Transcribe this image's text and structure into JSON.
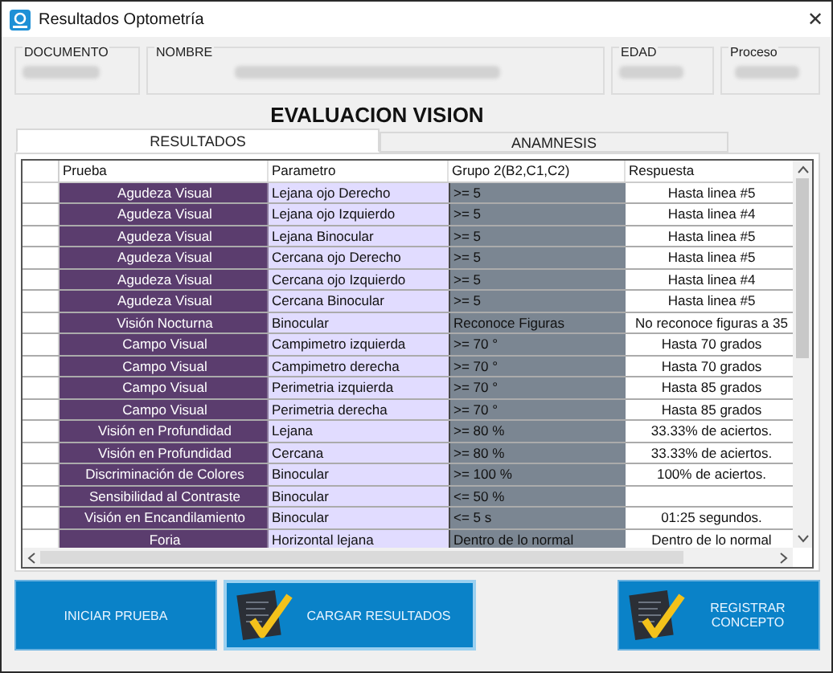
{
  "window": {
    "title": "Resultados Optometría",
    "close": "✕"
  },
  "fields": [
    {
      "label": "DOCUMENTO"
    },
    {
      "label": "NOMBRE"
    },
    {
      "label": "EDAD"
    },
    {
      "label": "Proceso"
    }
  ],
  "heading": "EVALUACION VISION",
  "tabs": [
    {
      "label": "RESULTADOS",
      "selected": true
    },
    {
      "label": "ANAMNESIS",
      "selected": false
    }
  ],
  "table": {
    "columns": [
      "Prueba",
      "Parametro",
      "Grupo 2(B2,C1,C2)",
      "Respuesta"
    ],
    "rows": [
      {
        "prueba": "Agudeza Visual",
        "parametro": "Lejana ojo Derecho",
        "grupo": ">= 5",
        "respuesta": "Hasta linea #5"
      },
      {
        "prueba": "Agudeza Visual",
        "parametro": "Lejana ojo Izquierdo",
        "grupo": ">= 5",
        "respuesta": "Hasta linea #4"
      },
      {
        "prueba": "Agudeza Visual",
        "parametro": "Lejana Binocular",
        "grupo": ">= 5",
        "respuesta": "Hasta linea #5"
      },
      {
        "prueba": "Agudeza Visual",
        "parametro": "Cercana ojo Derecho",
        "grupo": ">= 5",
        "respuesta": "Hasta linea #5"
      },
      {
        "prueba": "Agudeza Visual",
        "parametro": "Cercana ojo Izquierdo",
        "grupo": ">= 5",
        "respuesta": "Hasta linea #4"
      },
      {
        "prueba": "Agudeza Visual",
        "parametro": "Cercana Binocular",
        "grupo": ">= 5",
        "respuesta": "Hasta linea #5"
      },
      {
        "prueba": "Visión Nocturna",
        "parametro": "Binocular",
        "grupo": "Reconoce Figuras",
        "respuesta": "No reconoce figuras a 35"
      },
      {
        "prueba": "Campo Visual",
        "parametro": "Campimetro izquierda",
        "grupo": ">= 70 °",
        "respuesta": "Hasta 70 grados"
      },
      {
        "prueba": "Campo Visual",
        "parametro": "Campimetro derecha",
        "grupo": ">= 70 °",
        "respuesta": "Hasta 70 grados"
      },
      {
        "prueba": "Campo Visual",
        "parametro": "Perimetria izquierda",
        "grupo": ">= 70 °",
        "respuesta": "Hasta 85 grados"
      },
      {
        "prueba": "Campo Visual",
        "parametro": "Perimetria derecha",
        "grupo": ">= 70 °",
        "respuesta": "Hasta 85 grados"
      },
      {
        "prueba": "Visión en Profundidad",
        "parametro": "Lejana",
        "grupo": ">= 80 %",
        "respuesta": "33.33% de aciertos."
      },
      {
        "prueba": "Visión en Profundidad",
        "parametro": "Cercana",
        "grupo": ">= 80 %",
        "respuesta": "33.33% de aciertos."
      },
      {
        "prueba": "Discriminación de Colores",
        "parametro": "Binocular",
        "grupo": ">= 100 %",
        "respuesta": "100% de aciertos."
      },
      {
        "prueba": "Sensibilidad al Contraste",
        "parametro": "Binocular",
        "grupo": "<= 50 %"
      },
      {
        "prueba": "Visión en Encandilamiento",
        "parametro": "Binocular",
        "grupo": "<= 5 s",
        "respuesta": "01:25 segundos."
      },
      {
        "prueba": "Foria",
        "parametro": "Horizontal lejana",
        "grupo": "Dentro de lo normal",
        "respuesta": "Dentro de lo normal"
      }
    ]
  },
  "buttons": [
    {
      "label": "INICIAR PRUEBA",
      "icon": false
    },
    {
      "label": "CARGAR RESULTADOS",
      "icon": true
    },
    {
      "label": "REGISTRAR CONCEPTO",
      "icon": true
    }
  ]
}
